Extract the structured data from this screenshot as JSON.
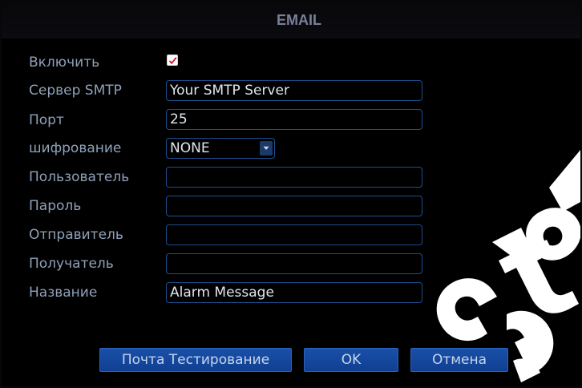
{
  "window": {
    "title": "EMAIL"
  },
  "form": {
    "enable": {
      "label": "Включить",
      "checked": true
    },
    "smtp_server": {
      "label": "Сервер SMTP",
      "value": "Your SMTP Server"
    },
    "port": {
      "label": "Порт",
      "value": "25"
    },
    "encryption": {
      "label": "шифрование",
      "value": "NONE"
    },
    "user": {
      "label": "Пользователь",
      "value": ""
    },
    "password": {
      "label": "Пароль",
      "value": ""
    },
    "sender": {
      "label": "Отправитель",
      "value": ""
    },
    "recipient": {
      "label": "Получатель",
      "value": ""
    },
    "subject": {
      "label": "Название",
      "value": "Alarm Message"
    }
  },
  "buttons": {
    "test": "Почта Тестирование",
    "ok": "OK",
    "cancel": "Отмена"
  },
  "colors": {
    "background": "#000000",
    "label": "#8fa1b8",
    "field_border": "#1d4f8f",
    "button": "#1646a0",
    "check": "#d0102a"
  },
  "icons": {
    "check": "check-mark-icon",
    "dropdown": "chevron-down-icon"
  }
}
